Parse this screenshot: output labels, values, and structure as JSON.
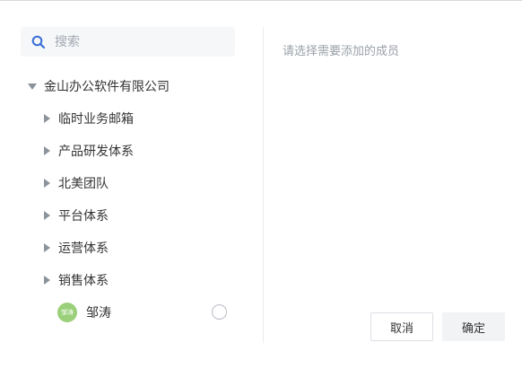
{
  "search": {
    "placeholder": "搜索"
  },
  "tree": {
    "root": {
      "label": "金山办公软件有限公司",
      "expanded": true
    },
    "children": [
      {
        "label": "临时业务邮箱"
      },
      {
        "label": "产品研发体系"
      },
      {
        "label": "北美团队"
      },
      {
        "label": "平台体系"
      },
      {
        "label": "运营体系"
      },
      {
        "label": "销售体系"
      }
    ],
    "member": {
      "avatar_text": "邹涛",
      "name": "邹涛",
      "selected": false
    }
  },
  "right_panel": {
    "hint": "请选择需要添加的成员"
  },
  "buttons": {
    "cancel": "取消",
    "confirm": "确定"
  },
  "colors": {
    "accent": "#3a6fd8",
    "avatar_bg": "#9bd07a"
  }
}
